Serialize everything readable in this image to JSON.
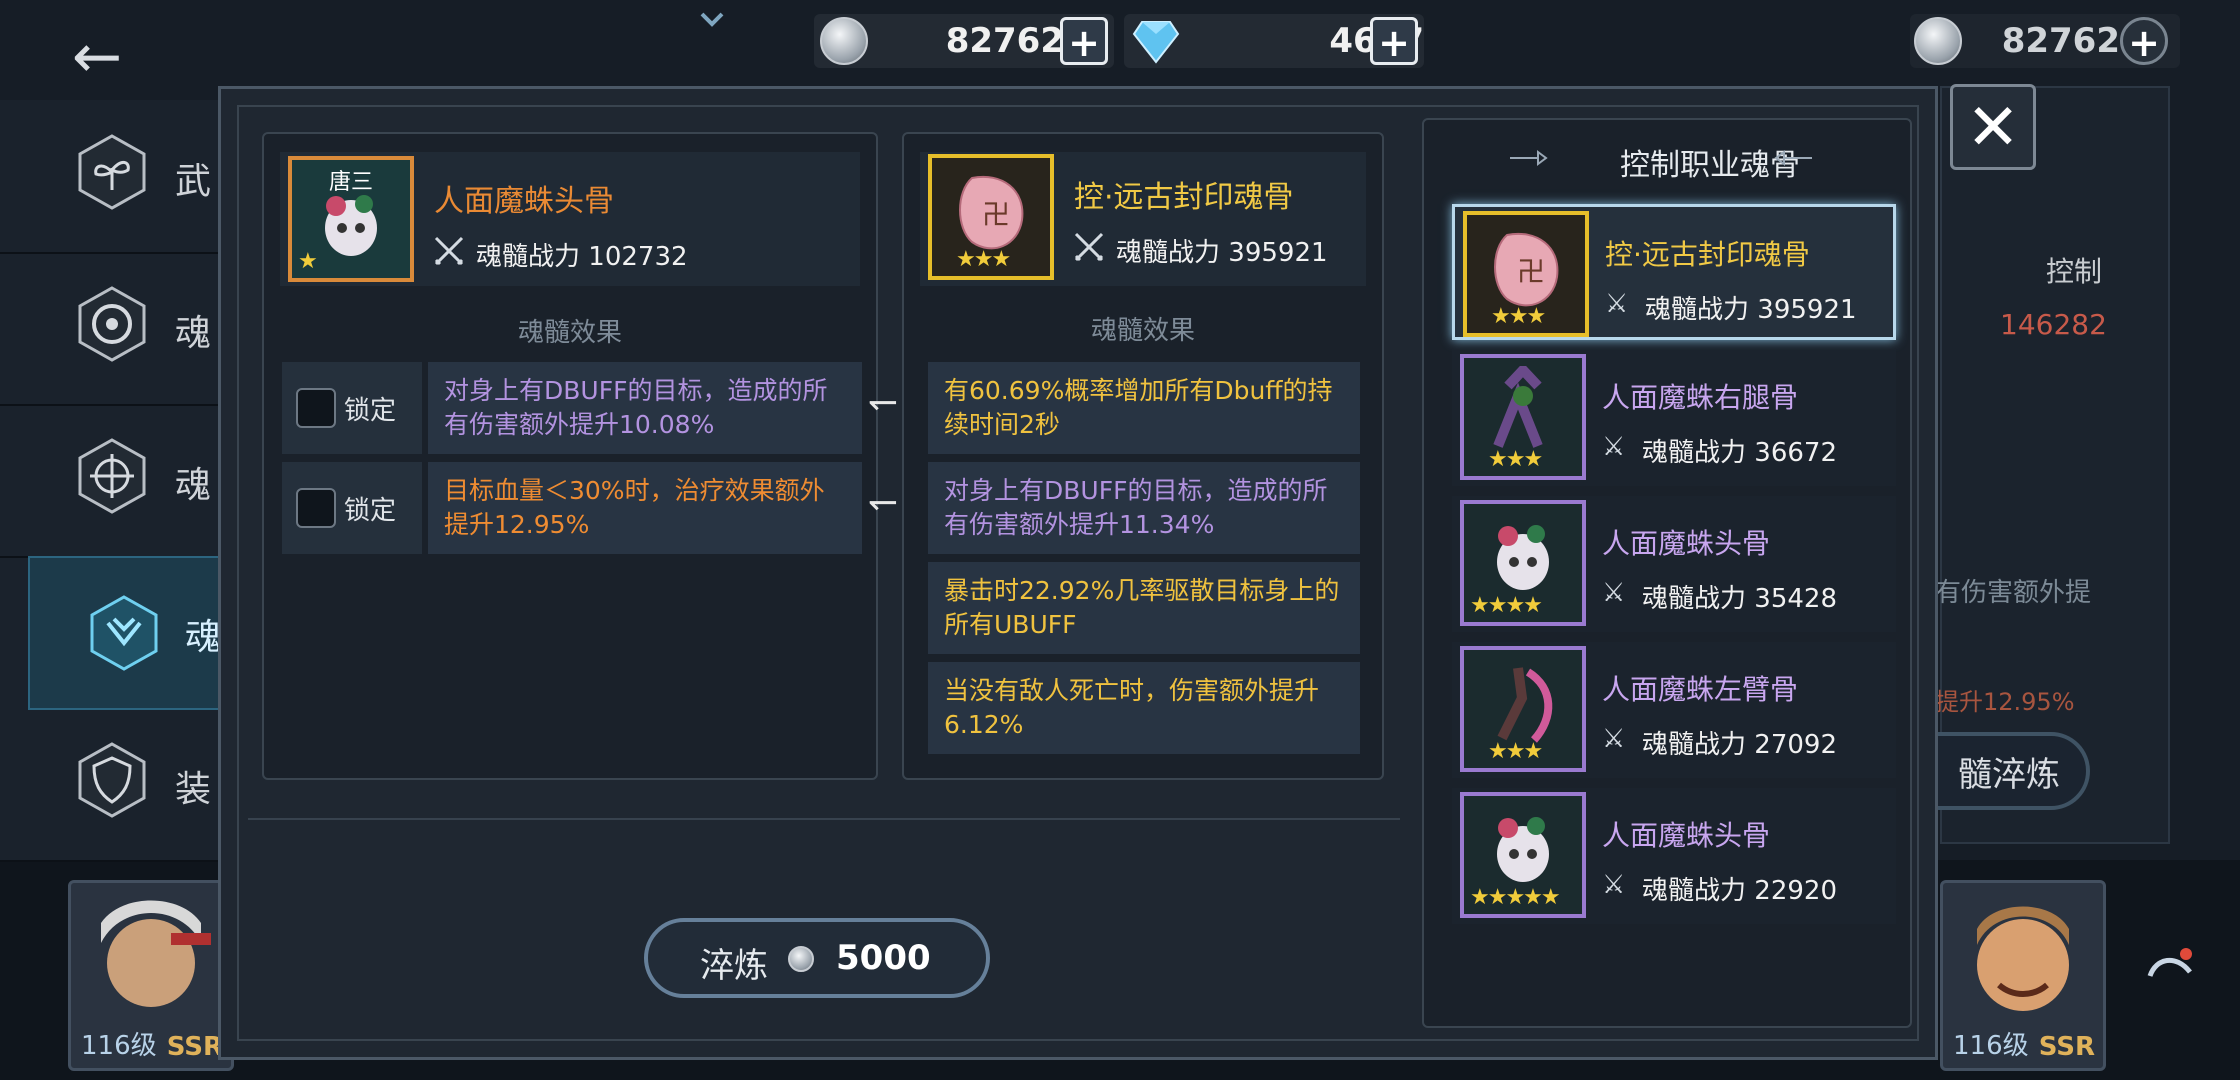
{
  "currency": {
    "coins": "82762",
    "gems": "4647",
    "right_coins": "82762"
  },
  "sidebar": {
    "items": [
      {
        "label": "武"
      },
      {
        "label": "魂"
      },
      {
        "label": "魂"
      },
      {
        "label": "魂"
      },
      {
        "label": "装"
      }
    ]
  },
  "background_right": {
    "control_label": "控制",
    "control_value": "146282",
    "text1": "有伤害额外提",
    "text2": "提升12.95%",
    "button": "髓淬炼"
  },
  "heroes": {
    "left": {
      "level": "116级",
      "grade": "SSR"
    },
    "right": {
      "level": "116级",
      "grade": "SSR"
    }
  },
  "current_item": {
    "owner": "唐三",
    "name": "人面魔蛛头骨",
    "power_label": "魂髓战力",
    "power_value": "102732",
    "stars": "★",
    "effects_title": "魂髓效果",
    "effects": [
      {
        "text": "对身上有DBUFF的目标，造成的所有伤害额外提升10.08%",
        "lock_label": "锁定"
      },
      {
        "text": "目标血量＜30%时，治疗效果额外提升12.95%",
        "lock_label": "锁定"
      }
    ]
  },
  "new_item": {
    "name": "控·远古封印魂骨",
    "power_label": "魂髓战力",
    "power_value": "395921",
    "stars": "★★★",
    "effects_title": "魂髓效果",
    "effects": [
      {
        "text": "有60.69%概率增加所有Dbuff的持续时间2秒"
      },
      {
        "text": "对身上有DBUFF的目标，造成的所有伤害额外提升11.34%"
      },
      {
        "text": "暴击时22.92%几率驱散目标身上的所有UBUFF"
      },
      {
        "text": "当没有敌人死亡时，伤害额外提升6.12%"
      }
    ]
  },
  "refine": {
    "label": "淬炼",
    "cost": "5000"
  },
  "list": {
    "title": "控制职业魂骨",
    "items": [
      {
        "name": "控·远古封印魂骨",
        "power_label": "魂髓战力",
        "power": "395921",
        "stars": "★★★"
      },
      {
        "name": "人面魔蛛右腿骨",
        "power_label": "魂髓战力",
        "power": "36672",
        "stars": "★★★"
      },
      {
        "name": "人面魔蛛头骨",
        "power_label": "魂髓战力",
        "power": "35428",
        "stars": "★★★★"
      },
      {
        "name": "人面魔蛛左臂骨",
        "power_label": "魂髓战力",
        "power": "27092",
        "stars": "★★★"
      },
      {
        "name": "人面魔蛛头骨",
        "power_label": "魂髓战力",
        "power": "22920",
        "stars": "★★★★★"
      }
    ]
  }
}
